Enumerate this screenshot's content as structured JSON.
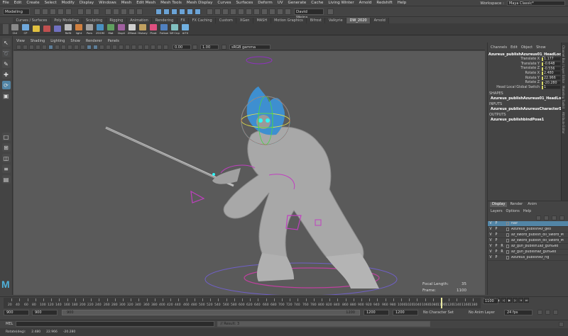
{
  "menubar": {
    "items": [
      "File",
      "Edit",
      "Create",
      "Select",
      "Modify",
      "Display",
      "Windows",
      "Mesh",
      "Edit Mesh",
      "Mesh Tools",
      "Mesh Display",
      "Curves",
      "Surfaces",
      "Deform",
      "UV",
      "Generate",
      "Cache",
      "Living Winter",
      "Arnold",
      "Redshift",
      "Help"
    ],
    "workspace_label": "Workspace :",
    "workspace_value": "Maya Classic*"
  },
  "statusline": {
    "mode": "Modeling",
    "user": "David Weins..."
  },
  "shelf_tabs": [
    "Curves / Surfaces",
    "Poly Modeling",
    "Sculpting",
    "Rigging",
    "Animation",
    "Rendering",
    "FX",
    "FX Caching",
    "Custom",
    "XGen",
    "MASH",
    "Motion Graphics",
    "Bifrost",
    "Valkyrie",
    "DW_2020",
    "Arnold"
  ],
  "shelf_active_tab": "DW_2020",
  "shelf_items": [
    {
      "label": "Ctrl",
      "color": "#8a8a8a"
    },
    {
      "label": "CP",
      "color": "#6fa8dc"
    },
    {
      "label": "",
      "color": "#e0c040"
    },
    {
      "label": "",
      "color": "#c05050"
    },
    {
      "label": "",
      "color": "#7070c0"
    },
    {
      "label": "Refit",
      "color": "#bbbbbb"
    },
    {
      "label": "light",
      "color": "#d08040"
    },
    {
      "label": "Pars",
      "color": "#a0a0a0"
    },
    {
      "label": "ZOOM",
      "color": "#4a90c0"
    },
    {
      "label": "Mat",
      "color": "#60a060"
    },
    {
      "label": "Dupli",
      "color": "#a060a0"
    },
    {
      "label": "ZMask",
      "color": "#d0d0d0"
    },
    {
      "label": "History",
      "color": "#c0a060"
    },
    {
      "label": "Pivot",
      "color": "#e05080"
    },
    {
      "label": "Follow",
      "color": "#5080c0"
    },
    {
      "label": "Wf Cnp",
      "color": "#80c0c0"
    },
    {
      "label": "AiTX",
      "color": "#70b0e0"
    }
  ],
  "viewport": {
    "menu": [
      "View",
      "Shading",
      "Lighting",
      "Show",
      "Renderer",
      "Panels"
    ],
    "field_a": "0.00",
    "field_b": "1.00",
    "colorspace": "sRGB gamma",
    "focal_label": "Focal Length:",
    "focal_value": "35",
    "frame_label": "Frame:",
    "frame_value": "1100"
  },
  "channelbox": {
    "menu": [
      "Channels",
      "Edit",
      "Object",
      "Show"
    ],
    "node": "Azureus_publishAzureus01_HeadLocal_ctrl",
    "attrs": [
      {
        "name": "Translate X",
        "value": "1.177"
      },
      {
        "name": "Translate Y",
        "value": "-0.648"
      },
      {
        "name": "Translate Z",
        "value": "-0.556"
      },
      {
        "name": "Rotate X",
        "value": "2.480"
      },
      {
        "name": "Rotate Y",
        "value": "22.966"
      },
      {
        "name": "Rotate Z",
        "value": "-20.280"
      },
      {
        "name": "Head Local Global Switch",
        "value": "1"
      }
    ],
    "shapes_label": "SHAPES",
    "shapes_item": "Azureus_publishAzureus01_HeadLocal...",
    "inputs_label": "INPUTS",
    "inputs_item": "Azureus_publishAzureusCharacterSet",
    "outputs_label": "OUTPUTS",
    "outputs_item": "Azureus_publishbindPose1"
  },
  "sidestrip": [
    "Channel Box / Layer Editor",
    "Modeling Toolkit",
    "Attribute Editor"
  ],
  "layers": {
    "tabs": [
      "Display",
      "Render",
      "Anim"
    ],
    "menu": [
      "Layers",
      "Options",
      "Help"
    ],
    "rows": [
      {
        "v": "V",
        "p": "P",
        "r": "",
        "name": "hair",
        "selected": true
      },
      {
        "v": "V",
        "p": "P",
        "r": "",
        "name": "Azureus_publishAz_geo",
        "selected": false
      },
      {
        "v": "V",
        "p": "P",
        "r": "",
        "name": "az_sword_publish_dll_Sword_M",
        "selected": false
      },
      {
        "v": "V",
        "p": "P",
        "r": "",
        "name": "az_sword_publish_dll_Sword_M",
        "selected": false
      },
      {
        "v": "V",
        "p": "P",
        "r": "R",
        "name": "az_gun_publish1az_gunGeo",
        "selected": false
      },
      {
        "v": "V",
        "p": "P",
        "r": "R",
        "name": "az_gun_publishaz_gunGeo",
        "selected": false
      },
      {
        "v": "V",
        "p": "P",
        "r": "",
        "name": "Azureus_publishAz_rig",
        "selected": false
      }
    ]
  },
  "timeslider": {
    "labels": [
      "20",
      "40",
      "60",
      "80",
      "100",
      "120",
      "140",
      "160",
      "180",
      "200",
      "220",
      "240",
      "260",
      "280",
      "300",
      "320",
      "340",
      "360",
      "380",
      "400",
      "420",
      "440",
      "460",
      "480",
      "500",
      "520",
      "540",
      "560",
      "580",
      "600",
      "620",
      "640",
      "660",
      "680",
      "700",
      "720",
      "740",
      "760",
      "780",
      "800",
      "820",
      "840",
      "860",
      "880",
      "900",
      "920",
      "940",
      "960",
      "980",
      "1000",
      "1020",
      "1040",
      "1060",
      "1080",
      "1100",
      "1120",
      "1140",
      "1160",
      "1180"
    ],
    "current_frame": "1100"
  },
  "range": {
    "start_outer": "900",
    "start_inner": "900",
    "range_start": "900",
    "range_end": "1200",
    "end_inner": "1200",
    "end_outer": "1200",
    "char_set": "No Character Set",
    "anim_layer": "No Anim Layer",
    "fps": "24 fps"
  },
  "cmdline": {
    "lang": "MEL",
    "result": "// Result: 3"
  },
  "helpline": {
    "text": "Rotate(deg):",
    "v1": "2.480",
    "v2": "22.966",
    "v3": "-20.280"
  }
}
